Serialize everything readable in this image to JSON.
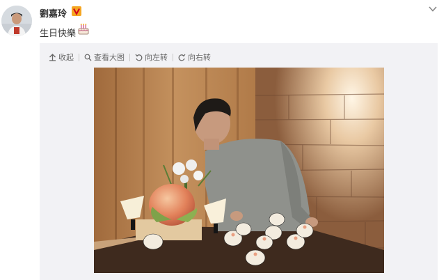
{
  "post": {
    "username": "劉嘉玲",
    "text": "生日快樂",
    "verified_badge": "V",
    "accent_color": "#ff8200",
    "badge_color": "#f5a623"
  },
  "toolbar": {
    "collapse_label": "收起",
    "view_large_label": "查看大图",
    "rotate_left_label": "向左转",
    "rotate_right_label": "向右转"
  },
  "icons": [
    "collapse-arrow-icon",
    "magnifier-icon",
    "rotate-left-icon",
    "rotate-right-icon",
    "chevron-down-icon",
    "cake-emoji-icon",
    "verified-badge-icon"
  ]
}
